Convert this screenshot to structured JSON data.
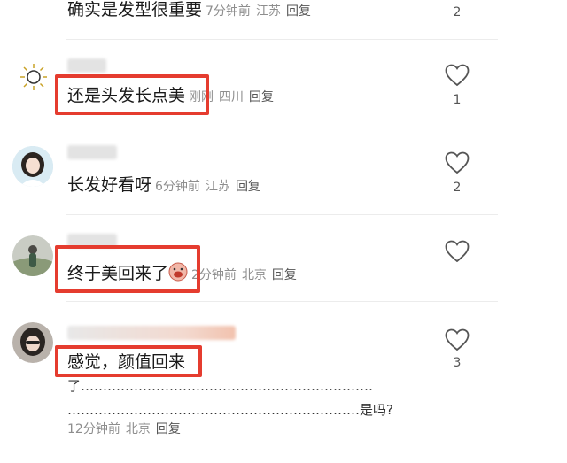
{
  "comments": [
    {
      "text": "确实是发型很重要",
      "time": "7分钟前",
      "location": "江苏",
      "reply": "回复",
      "likes": "2"
    },
    {
      "text": "还是头发长点美",
      "time": "刚刚",
      "location": "四川",
      "reply": "回复",
      "likes": "1"
    },
    {
      "text": "长发好看呀",
      "time": "6分钟前",
      "location": "江苏",
      "reply": "回复",
      "likes": "2"
    },
    {
      "text": "终于美回来了",
      "time": "2分钟前",
      "location": "北京",
      "reply": "回复",
      "likes": ""
    },
    {
      "text_line1": "感觉，颜值回来",
      "text_line2": "了…………………………………………………………",
      "text_line3": "…………………………………………………………是吗?",
      "time": "12分钟前",
      "location": "北京",
      "reply": "回复",
      "likes": "3"
    }
  ],
  "colors": {
    "highlight": "#e53c2f",
    "meta": "#8e8e8e"
  },
  "icons": {
    "like": "heart-outline-icon",
    "emoji": "crying-face-emoji"
  }
}
